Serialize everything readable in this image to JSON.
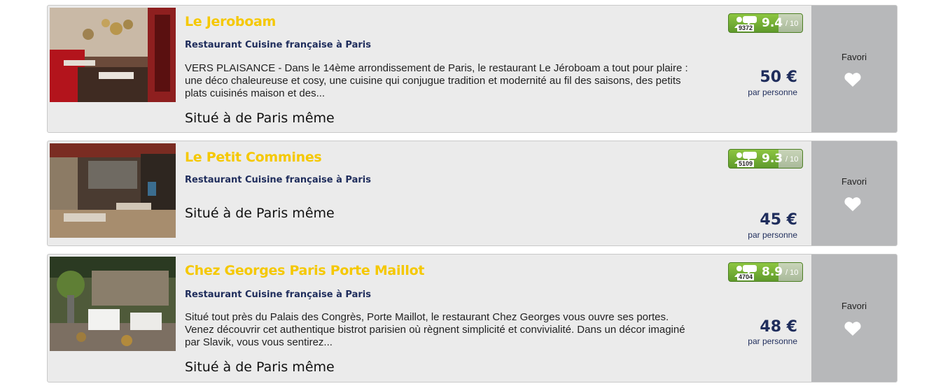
{
  "restaurants": [
    {
      "name": "Le Jeroboam",
      "category": "Restaurant Cuisine française à Paris",
      "description": "VERS PLAISANCE - Dans le 14ème arrondissement de Paris, le restaurant Le Jéroboam a tout pour plaire : une déco chaleureuse et cosy, une cuisine qui conjugue tradition et modernité au fil des saisons, des petits plats cuisinés maison et des...",
      "location": "Situé à de Paris même",
      "reviews_count": "9372",
      "score": "9.4",
      "score_scale": "/ 10",
      "price": "50 €",
      "price_unit": "par personne",
      "favorite_label": "Favori",
      "favorite_icon": "heart-icon"
    },
    {
      "name": "Le Petit Commines",
      "category": "Restaurant Cuisine française à Paris",
      "description": "",
      "location": "Situé à de Paris même",
      "reviews_count": "5109",
      "score": "9.3",
      "score_scale": "/ 10",
      "price": "45 €",
      "price_unit": "par personne",
      "favorite_label": "Favori",
      "favorite_icon": "heart-icon"
    },
    {
      "name": "Chez Georges Paris Porte Maillot",
      "category": "Restaurant Cuisine française à Paris",
      "description": "Situé tout près du Palais des Congrès, Porte Maillot, le restaurant Chez Georges vous ouvre ses portes. Venez découvrir cet authentique bistrot parisien où règnent simplicité et convivialité. Dans un décor imaginé par Slavik, vous vous sentirez...",
      "location": "Situé à de Paris même",
      "reviews_count": "4704",
      "score": "8.9",
      "score_scale": "/ 10",
      "price": "48 €",
      "price_unit": "par personne",
      "favorite_label": "Favori",
      "favorite_icon": "heart-icon"
    }
  ],
  "colors": {
    "title": "#f5c800",
    "navy": "#1f2d5c",
    "card_bg": "#ebebeb",
    "favorite_bg": "#b7b8ba",
    "rating_green": "#6fae35"
  }
}
